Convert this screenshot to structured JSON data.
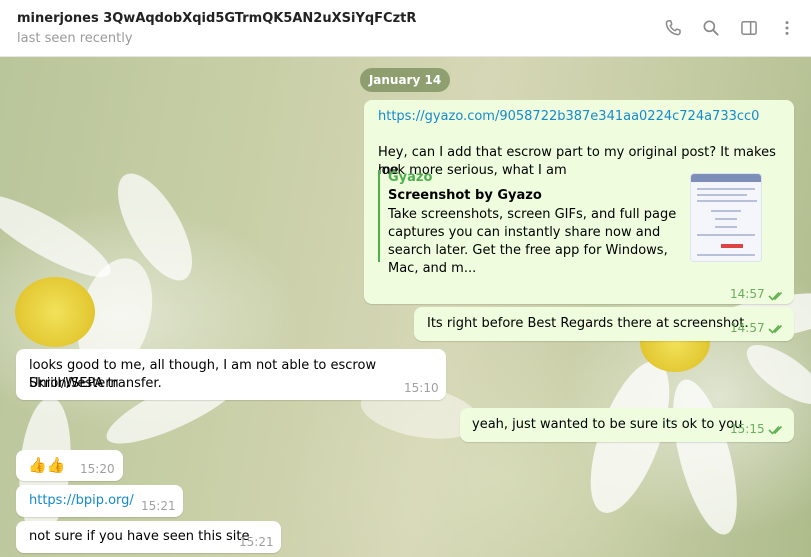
{
  "header": {
    "contact_name": "minerjones 3QwAqdobXqid5GTrmQK5AN2uXSiYqFCztR",
    "status": "last seen recently",
    "icons": [
      "phone-icon",
      "search-icon",
      "sidebar-toggle-icon",
      "more-vertical-icon"
    ]
  },
  "chat": {
    "date_separator": "January 14",
    "msg1": {
      "link": "https://gyazo.com/9058722b387e341aa0224c724a733cc0",
      "text_line1": "Hey, can I add that escrow part to my original post? It makes me",
      "text_line2": "look more serious, what I am",
      "preview_site": "Gyazo",
      "preview_title": "Screenshot by Gyazo",
      "preview_desc": "Take screenshots, screen GIFs, and full page captures you can instantly share now and search later. Get the free app for Windows, Mac, and m...",
      "time": "14:57"
    },
    "msg2": {
      "text": "Its right before Best Regards there at screenshot.",
      "time": "14:57"
    },
    "msg3": {
      "text_line1": "looks good to me, all though, I am not able to escrow Skrill/Western",
      "text_line2": "Union/SEPA transfer.",
      "time": "15:10"
    },
    "msg4": {
      "text": "yeah, just wanted to be sure its ok to you",
      "time": "15:15"
    },
    "msg5": {
      "text": "👍👍",
      "time": "15:20"
    },
    "msg6": {
      "text": "https://bpip.org/",
      "time": "15:21"
    },
    "msg7": {
      "text": "not sure if you have seen this site",
      "time": "15:21"
    }
  },
  "colors": {
    "outgoing_bubble": "#effdde",
    "incoming_bubble": "#ffffff",
    "link": "#168acd",
    "preview_accent": "#4fae4e",
    "date_pill": "#788c5a"
  }
}
